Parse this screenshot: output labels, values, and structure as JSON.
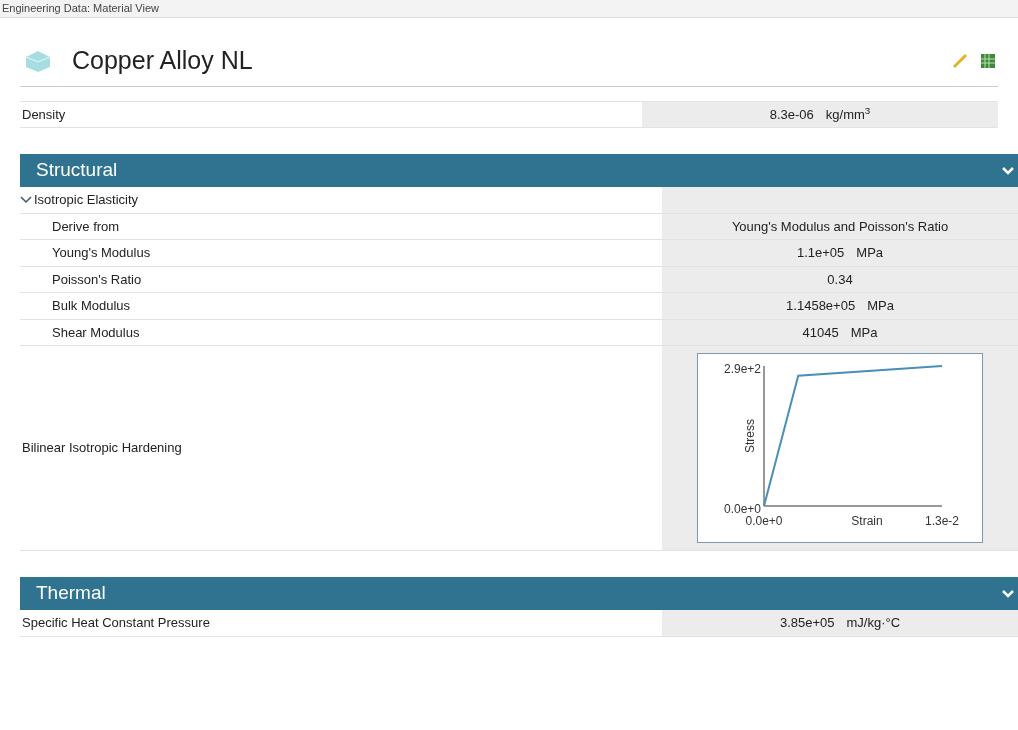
{
  "window": {
    "title": "Engineering Data: Material View"
  },
  "material": {
    "name": "Copper Alloy NL"
  },
  "top_properties": [
    {
      "name": "Density",
      "value": "8.3e-06",
      "unit": "kg/mm$^{3}$"
    }
  ],
  "sections": [
    {
      "title": "Structural",
      "expanded": true,
      "groups": [
        {
          "name": "Isotropic Elasticity",
          "expanded": true,
          "rows": [
            {
              "kind": "text",
              "name": "Derive from",
              "value": "Young's Modulus and Poisson's Ratio"
            },
            {
              "kind": "text",
              "name": "Young's Modulus",
              "value": "1.1e+05",
              "unit": "MPa"
            },
            {
              "kind": "text",
              "name": "Poisson's Ratio",
              "value": "0.34"
            },
            {
              "kind": "text",
              "name": "Bulk Modulus",
              "value": "1.1458e+05",
              "unit": "MPa"
            },
            {
              "kind": "text",
              "name": "Shear Modulus",
              "value": "41045",
              "unit": "MPa"
            }
          ]
        }
      ],
      "rows": [
        {
          "kind": "chart",
          "name": "Bilinear Isotropic Hardening",
          "chart_data": {
            "type": "line",
            "xlabel": "Strain",
            "ylabel": "Stress",
            "x": [
              0,
              0.0025,
              0.013
            ],
            "series": [
              {
                "color": "#4a8fb5",
                "values": [
                  0,
                  270,
                  290
                ]
              }
            ],
            "xlim": [
              0,
              0.013
            ],
            "ylim": [
              0,
              290
            ],
            "xticks": [
              {
                "value": 0,
                "label": "0.0e+0"
              },
              {
                "value": 0.013,
                "label": "1.3e-2"
              }
            ],
            "yticks": [
              {
                "value": 0,
                "label": "0.0e+0"
              },
              {
                "value": 290,
                "label": "2.9e+2"
              }
            ]
          }
        }
      ]
    },
    {
      "title": "Thermal",
      "expanded": true,
      "rows": [
        {
          "kind": "text",
          "name": "Specific Heat Constant Pressure",
          "value": "3.85e+05",
          "unit": "mJ/kg·°C"
        }
      ]
    }
  ]
}
